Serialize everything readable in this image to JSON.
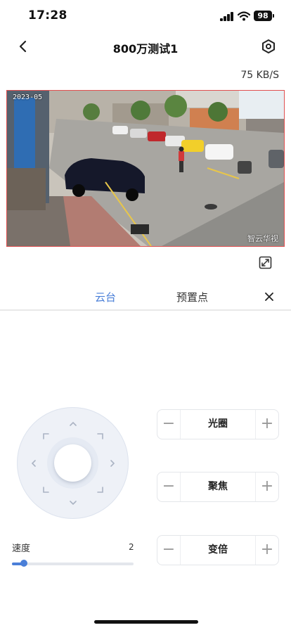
{
  "status_bar": {
    "time": "17:28",
    "battery": "98",
    "signal_icon": "cellular-signal-icon",
    "wifi_icon": "wifi-icon"
  },
  "header": {
    "title": "800万测试1",
    "back_icon": "chevron-left-icon",
    "settings_icon": "hexagon-settings-icon"
  },
  "stream": {
    "bitrate": "75 KB/S"
  },
  "video": {
    "timestamp": "2023-05",
    "watermark": "智云华视",
    "border_color": "#e05050"
  },
  "tabs": {
    "items": [
      {
        "label": "云台",
        "active": true
      },
      {
        "label": "预置点",
        "active": false
      }
    ],
    "active_color": "#4a7fd8",
    "close_icon": "close-icon"
  },
  "ptz": {
    "joystick_icon": "directional-pad-icon",
    "speed_label": "速度",
    "speed_value": "2",
    "speed_fraction": 0.1,
    "controls": [
      {
        "label": "光圈",
        "minus": "−",
        "plus": "+"
      },
      {
        "label": "聚焦",
        "minus": "−",
        "plus": "+"
      },
      {
        "label": "变倍",
        "minus": "−",
        "plus": "+"
      }
    ]
  }
}
